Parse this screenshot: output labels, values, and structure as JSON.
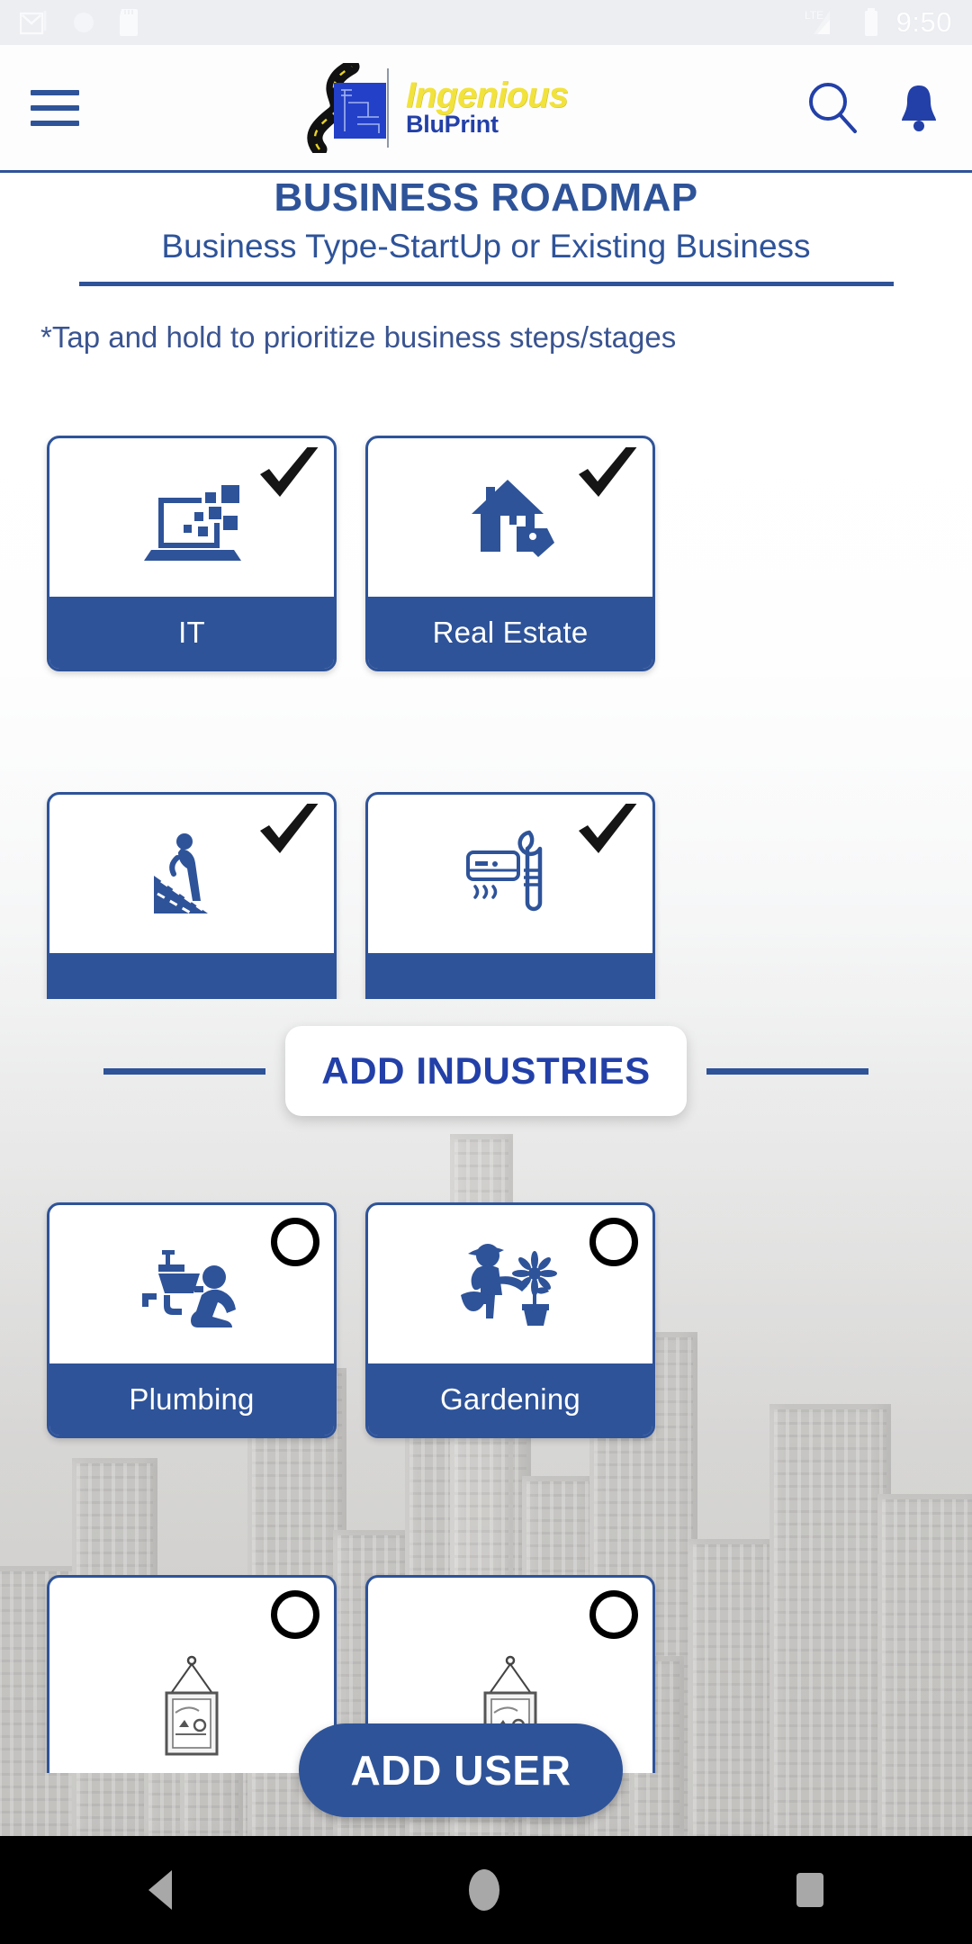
{
  "statusbar": {
    "time": "9:50",
    "icons": [
      "gmail-icon",
      "sync-circle-icon",
      "sd-card-icon",
      "lte-signal-icon",
      "battery-icon"
    ],
    "network": "LTE"
  },
  "appbar": {
    "menu_icon": "hamburger-menu-icon",
    "logo_title": "Ingenious",
    "logo_subtitle": "BluPrint",
    "search_icon": "search-icon",
    "notification_icon": "bell-icon"
  },
  "page": {
    "title": "BUSINESS ROADMAP",
    "subtitle": "Business Type-StartUp or Existing Business",
    "hint": "*Tap and hold to prioritize business steps/stages"
  },
  "section_divider": {
    "label": "ADD INDUSTRIES"
  },
  "selected_industries": [
    {
      "label": "IT",
      "icon": "laptop-data-icon",
      "state": "checked"
    },
    {
      "label": "Real Estate",
      "icon": "house-tag-icon",
      "state": "checked"
    },
    {
      "label": "",
      "icon": "roofing-worker-icon",
      "state": "checked"
    },
    {
      "label": "",
      "icon": "hvac-wrench-icon",
      "state": "checked"
    }
  ],
  "available_industries": [
    {
      "label": "Plumbing",
      "icon": "plumber-sink-icon",
      "state": "unchecked"
    },
    {
      "label": "Gardening",
      "icon": "gardener-flower-icon",
      "state": "unchecked"
    },
    {
      "label": "",
      "icon": "hanging-frame-icon",
      "state": "unchecked"
    },
    {
      "label": "",
      "icon": "hanging-frame-icon",
      "state": "unchecked"
    }
  ],
  "footer": {
    "add_user_label": "ADD USER"
  },
  "navbar": {
    "back": "back-nav-icon",
    "home": "home-nav-icon",
    "recents": "recents-nav-icon"
  },
  "colors": {
    "brand_blue": "#2e5399",
    "logo_yellow": "#f2e23c",
    "logo_blue": "#2340a8",
    "statusbar_bg": "#eceef2",
    "navbar_bg": "#000000"
  }
}
